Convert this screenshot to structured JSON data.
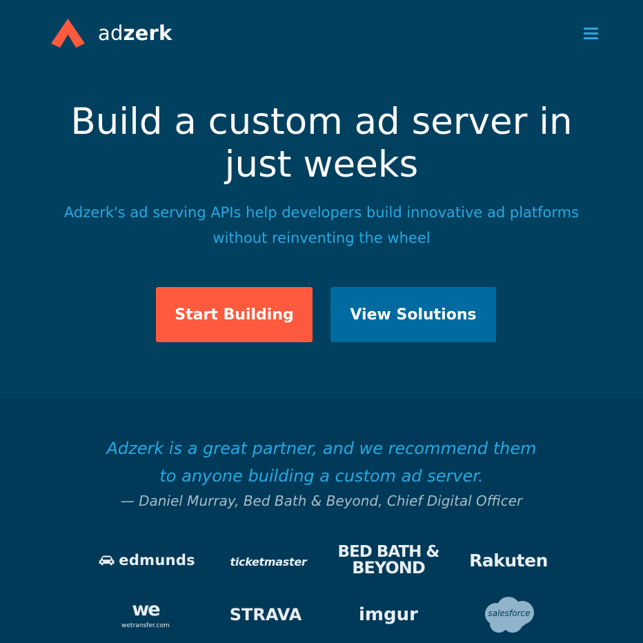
{
  "header": {
    "brand_light": "ad",
    "brand_bold": "zerk",
    "logo_icon": "adzerk-chevron-logo",
    "menu_icon": "hamburger-menu-icon"
  },
  "hero": {
    "headline_line1": "Build a custom ad server in",
    "headline_line2": "just weeks",
    "subhead_line1": "Adzerk's ad serving APIs help developers build innovative ad platforms",
    "subhead_line2": "without reinventing the wheel",
    "primary_cta": "Start Building",
    "secondary_cta": "View Solutions"
  },
  "testimonial": {
    "quote_line1": "Adzerk is a great partner, and we recommend them",
    "quote_line2": "to anyone building a custom ad server.",
    "attribution": "— Daniel Murray, Bed Bath & Beyond, Chief Digital Officer"
  },
  "clients": {
    "edmunds": "edmunds",
    "ticketmaster": "ticketmaster",
    "bbb_line1": "BED BATH &",
    "bbb_line2": "BEYOND",
    "rakuten": "Rakuten",
    "wetransfer_mark": "we",
    "wetransfer_url": "wetransfer.com",
    "strava": "STRAVA",
    "imgur": "imgur",
    "salesforce": "salesforce"
  },
  "colors": {
    "hero_bg": "#01405f",
    "lower_bg": "#003a58",
    "accent_orange": "#ff5a3d",
    "accent_blue": "#28a9e1",
    "button_blue": "#006ba0"
  }
}
